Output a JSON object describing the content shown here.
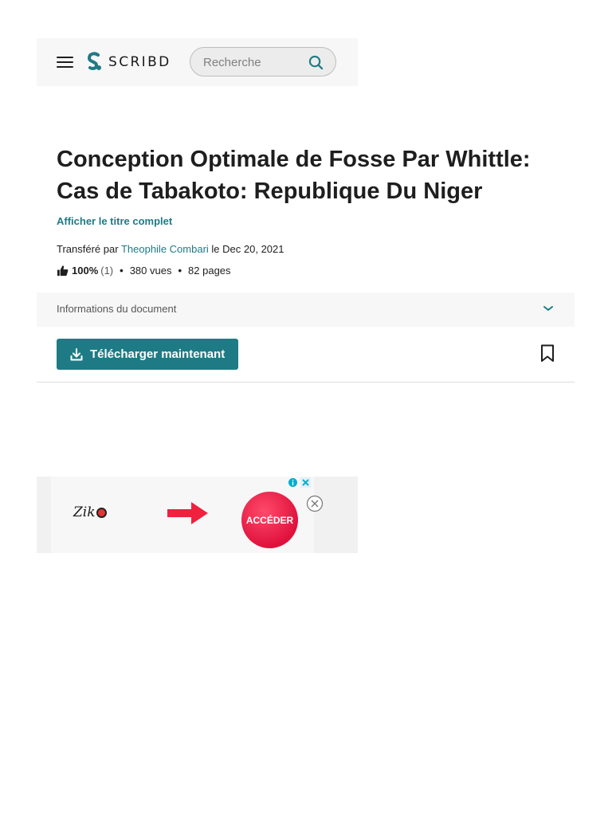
{
  "header": {
    "brand": "SCRIBD",
    "search_placeholder": "Recherche",
    "brand_color": "#1e7b85"
  },
  "document": {
    "title": "Conception Optimale de Fosse Par Whittle: Cas de Tabakoto: Republique Du Niger",
    "show_full_title": "Afficher le titre complet",
    "uploaded_prefix": "Transféré par",
    "uploader": "Theophile Combari",
    "uploaded_date": "le Dec 20, 2021",
    "rating_percent": "100%",
    "rating_count": "(1)",
    "views": "380 vues",
    "pages": "82 pages",
    "info_label": "Informations du document",
    "download_label": "Télécharger maintenant"
  },
  "ad": {
    "logo_text": "Zik",
    "cta_label": "ACCÉDER"
  },
  "icons": {
    "menu": "hamburger-icon",
    "search": "search-icon",
    "thumb": "thumbs-up-icon",
    "chevron": "chevron-down-icon",
    "download": "download-icon",
    "bookmark": "bookmark-icon"
  }
}
